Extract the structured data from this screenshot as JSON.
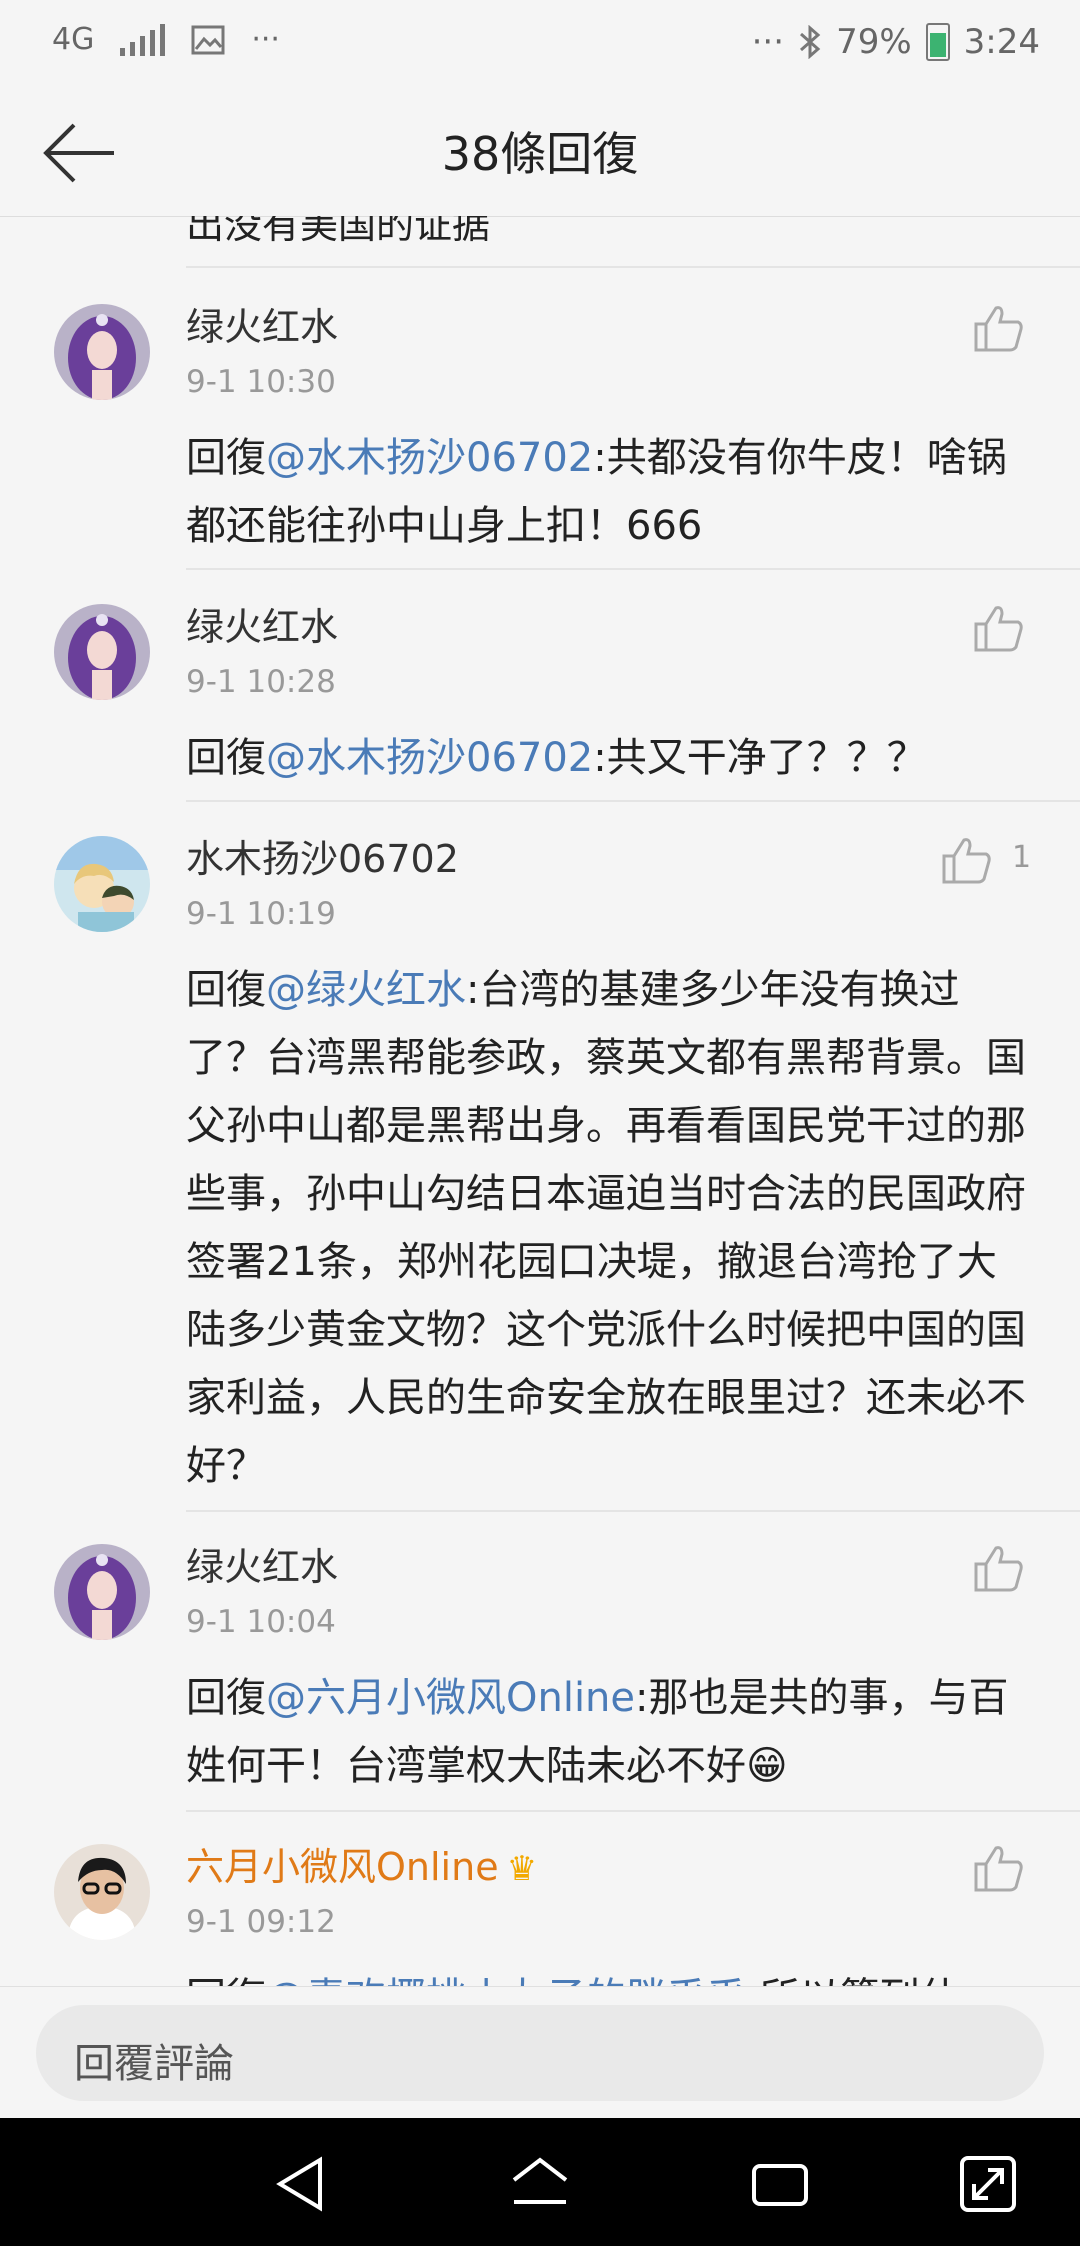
{
  "status_bar": {
    "network": "4G",
    "more_left": "···",
    "more_right": "···",
    "battery": "79%",
    "time": "3:24"
  },
  "header": {
    "title": "38條回復"
  },
  "list": {
    "partial_top_text": "出没有美国的证据",
    "comments": [
      {
        "name": "绿火红水",
        "time": "9-1 10:30",
        "prefix": "回復",
        "mention": "@水木扬沙06702",
        "body": ":共都没有你牛皮！啥锅都还能往孙中山身上扣！666",
        "likes": ""
      },
      {
        "name": "绿火红水",
        "time": "9-1 10:28",
        "prefix": "回復",
        "mention": "@水木扬沙06702",
        "body": ":共又干净了？？？",
        "likes": ""
      },
      {
        "name": "水木扬沙06702",
        "time": "9-1 10:19",
        "prefix": "回復",
        "mention": "@绿火红水",
        "body": ":台湾的基建多少年没有换过了？台湾黑帮能参政，蔡英文都有黑帮背景。国父孙中山都是黑帮出身。再看看国民党干过的那些事，孙中山勾结日本逼迫当时合法的民国政府签署21条，郑州花园口决堤，撤退台湾抢了大陆多少黄金文物？这个党派什么时候把中国的国家利益，人民的生命安全放在眼里过？还未必不好？",
        "likes": "1"
      },
      {
        "name": "绿火红水",
        "time": "9-1 10:04",
        "prefix": "回復",
        "mention": "@六月小微风Online",
        "body": ":那也是共的事，与百姓何干！台湾掌权大陆未必不好😁",
        "likes": ""
      },
      {
        "name": "六月小微风Online",
        "time": "9-1 09:12",
        "prefix": "回復",
        "mention": "@青欢椰桃小丸子的胖乎乎",
        "body": ":所以篡列什",
        "likes": ""
      }
    ]
  },
  "input": {
    "placeholder": "回覆評論"
  }
}
